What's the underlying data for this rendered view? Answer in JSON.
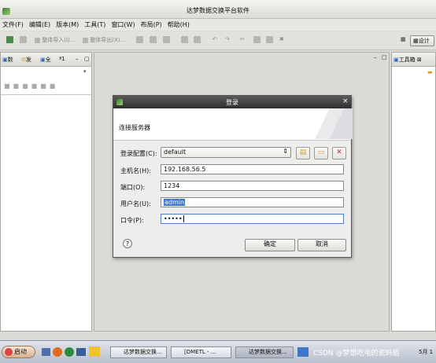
{
  "window": {
    "title": "达梦数据交换平台软件"
  },
  "menu": [
    "文件(F)",
    "编辑(E)",
    "版本(M)",
    "工具(T)",
    "窗口(W)",
    "布局(P)",
    "帮助(H)"
  ],
  "toolbar": {
    "import_label": "整体导入(I)...",
    "export_label": "整体导出(X)...",
    "design_label": "设计"
  },
  "left_panel": {
    "tabs": [
      "数",
      "发",
      "全",
      "ª1"
    ]
  },
  "right_panel": {
    "tab_label": "工具箱"
  },
  "dialog": {
    "title": "登录",
    "banner_text": "连接服务器",
    "fields": {
      "config": {
        "label": "登录配置(C):",
        "value": "default"
      },
      "host": {
        "label": "主机名(H):",
        "value": "192.168.56.5"
      },
      "port": {
        "label": "端口(O):",
        "value": "1234"
      },
      "user": {
        "label": "用户名(U):",
        "value": "admin"
      },
      "password": {
        "label": "口令(P):",
        "value": "•••••"
      }
    },
    "ok_label": "确定",
    "cancel_label": "取消"
  },
  "taskbar": {
    "start_label": "启动",
    "tasks": [
      "达梦数据交换...",
      "[DMETL - ...",
      "达梦数据交换..."
    ],
    "watermark": "CSDN @梦想吃电的瓷妈姐",
    "clock": "5月 1"
  },
  "colors": {
    "close_red": "#cc2222",
    "selection": "#3f77c9",
    "dialog_title": "#3a3a3a"
  }
}
